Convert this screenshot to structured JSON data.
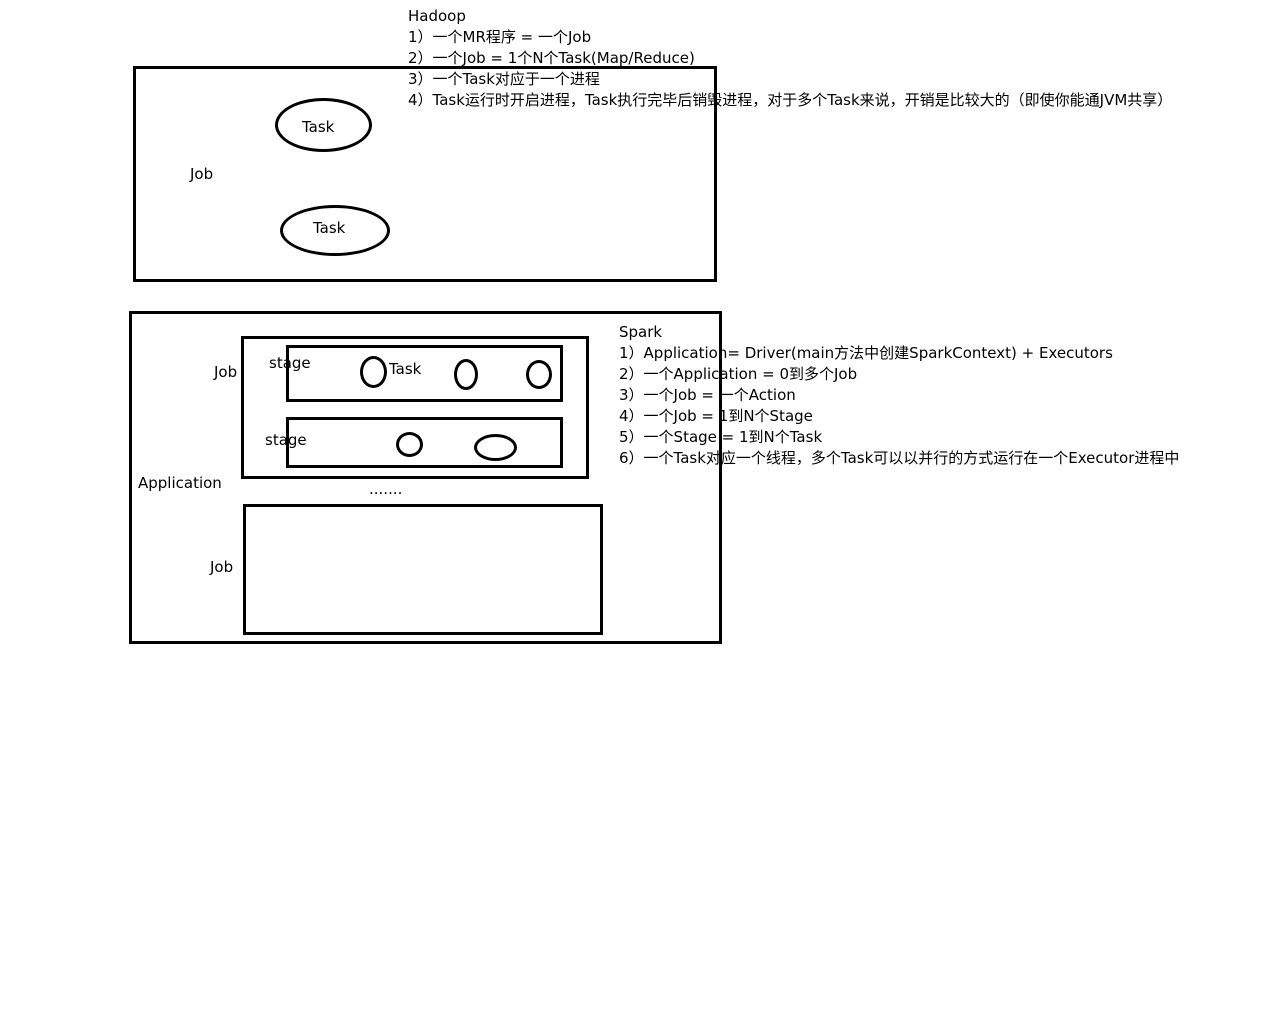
{
  "hadoop": {
    "title": "Hadoop",
    "lines": [
      "1）一个MR程序 = 一个Job",
      "2）一个Job = 1个N个Task(Map/Reduce)",
      "3）一个Task对应于一个进程",
      "4）Task运行时开启进程，Task执行完毕后销毁进程，对于多个Task来说，开销是比较大的（即使你能通JVM共享）"
    ],
    "diagram": {
      "job_label": "Job",
      "task_label_1": "Task",
      "task_label_2": "Task"
    }
  },
  "spark": {
    "title": "Spark",
    "lines": [
      "1）Application= Driver(main方法中创建SparkContext) + Executors",
      "2）一个Application =  0到多个Job",
      "3）一个Job = 一个Action",
      "4）一个Job = 1到N个Stage",
      "5）一个Stage = 1到N个Task",
      "6）一个Task对应一个线程，多个Task可以以并行的方式运行在一个Executor进程中"
    ],
    "diagram": {
      "application_label": "Application",
      "job_label_1": "Job",
      "job_label_2": "Job",
      "stage_label_1": "stage",
      "stage_label_2": "stage",
      "task_label": "Task",
      "ellipsis": "......."
    }
  }
}
